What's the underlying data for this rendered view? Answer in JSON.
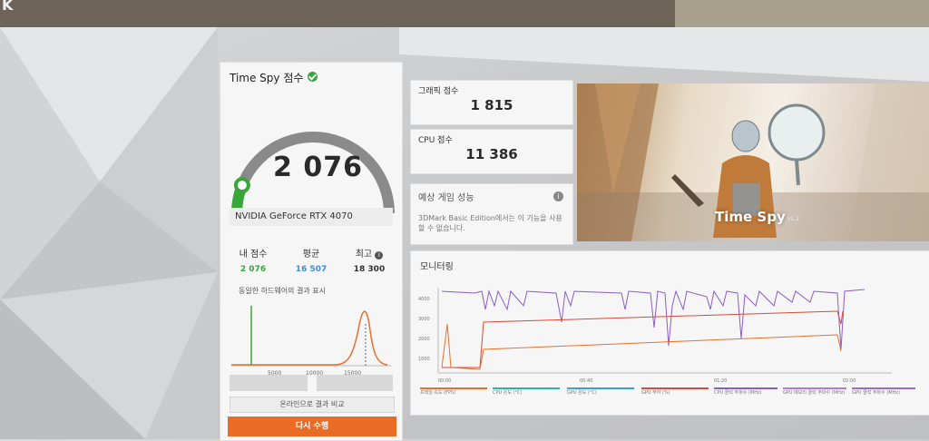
{
  "app": {
    "corner_glyph": "K"
  },
  "score_panel": {
    "title": "Time Spy 점수",
    "score": "2 076",
    "gpu": "NVIDIA GeForce RTX 4070",
    "stats": [
      {
        "label": "내 점수",
        "value": "2 076",
        "color": "#3aa53a"
      },
      {
        "label": "평균",
        "value": "16 507",
        "color": "#3b8ed8"
      },
      {
        "label": "최고",
        "value": "18 300",
        "color": "#333333"
      }
    ],
    "histogram_title": "동일한 하드웨어의 결과 표시",
    "histogram_ticks": [
      "5000",
      "10000",
      "15000"
    ],
    "compare_button": "온라인으로 결과 비교",
    "rerun_button": "다시 수행",
    "gauge_fraction": 0.12
  },
  "graphics_score": {
    "label": "그래픽 점수",
    "value": "1 815"
  },
  "cpu_score": {
    "label": "CPU 점수",
    "value": "11 386"
  },
  "performance": {
    "title": "예상 게임 성능",
    "text": "3DMark Basic Edition에서는 이 기능을 사용할 수 없습니다."
  },
  "hero": {
    "title": "Time Spy",
    "version": "v1.2"
  },
  "monitoring": {
    "title": "모니터링",
    "y_ticks": [
      "4000",
      "3000",
      "2000",
      "1000"
    ],
    "x_ticks": [
      "00:00",
      "00:40",
      "01:20",
      "02:00"
    ],
    "legend": [
      {
        "label": "프레임 속도 (FPS)",
        "color": "#e8702a"
      },
      {
        "label": "CPU 온도 (°C)",
        "color": "#2bb3a8"
      },
      {
        "label": "GPU 온도 (°C)",
        "color": "#38a0d8"
      },
      {
        "label": "GPU 부하 (%)",
        "color": "#d84a3a"
      },
      {
        "label": "CPU 클럭 주파수 (MHz)",
        "color": "#8a5cc8"
      },
      {
        "label": "GPU 메모리 클럭 주파수 (MHz)",
        "color": "#b07ad8"
      },
      {
        "label": "GPU 클럭 주파수 (MHz)",
        "color": "#9a6ad0"
      }
    ]
  },
  "colors": {
    "accent": "#ea6b23",
    "gauge_green": "#3aa53a",
    "gauge_gray": "#8a8a8a"
  }
}
